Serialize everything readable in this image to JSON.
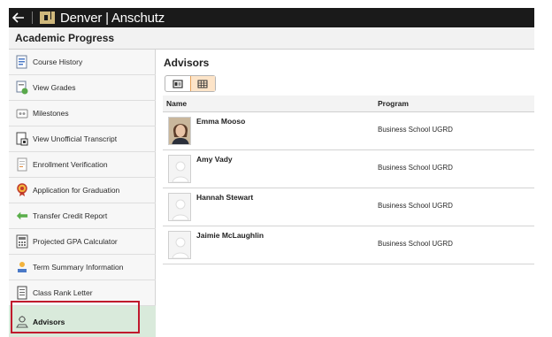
{
  "topbar": {
    "back_icon": "back-arrow-icon",
    "logo_icon": "cu-logo-icon",
    "brand": "Denver | Anschutz"
  },
  "header": {
    "title": "Academic Progress"
  },
  "sidebar": {
    "items": [
      {
        "label": "Course History",
        "icon": "course-history-icon"
      },
      {
        "label": "View Grades",
        "icon": "grades-icon"
      },
      {
        "label": "Milestones",
        "icon": "milestones-icon"
      },
      {
        "label": "View Unofficial Transcript",
        "icon": "transcript-icon"
      },
      {
        "label": "Enrollment Verification",
        "icon": "verification-icon"
      },
      {
        "label": "Application for Graduation",
        "icon": "graduation-icon"
      },
      {
        "label": "Transfer Credit Report",
        "icon": "transfer-icon"
      },
      {
        "label": "Projected GPA Calculator",
        "icon": "calculator-icon"
      },
      {
        "label": "Term Summary Information",
        "icon": "term-summary-icon"
      },
      {
        "label": "Class Rank Letter",
        "icon": "letter-icon"
      },
      {
        "label": "Advisors",
        "icon": "advisors-icon"
      }
    ],
    "active": "Advisors"
  },
  "main": {
    "title": "Advisors",
    "view_toggle": [
      "card-view-icon",
      "grid-view-icon"
    ],
    "table": {
      "columns": [
        "Name",
        "Program"
      ],
      "rows": [
        {
          "name": "Emma Mooso",
          "program": "Business School UGRD",
          "photo": "photo"
        },
        {
          "name": "Amy Vady",
          "program": "Business School UGRD",
          "photo": "placeholder"
        },
        {
          "name": "Hannah Stewart",
          "program": "Business School UGRD",
          "photo": "placeholder"
        },
        {
          "name": "Jaimie McLaughlin",
          "program": "Business School UGRD",
          "photo": "placeholder"
        }
      ]
    }
  },
  "colors": {
    "topbar": "#1a1a1a",
    "active_item": "#d9eadb",
    "highlight": "#c0182d",
    "logo_gold": "#cfb87c"
  }
}
